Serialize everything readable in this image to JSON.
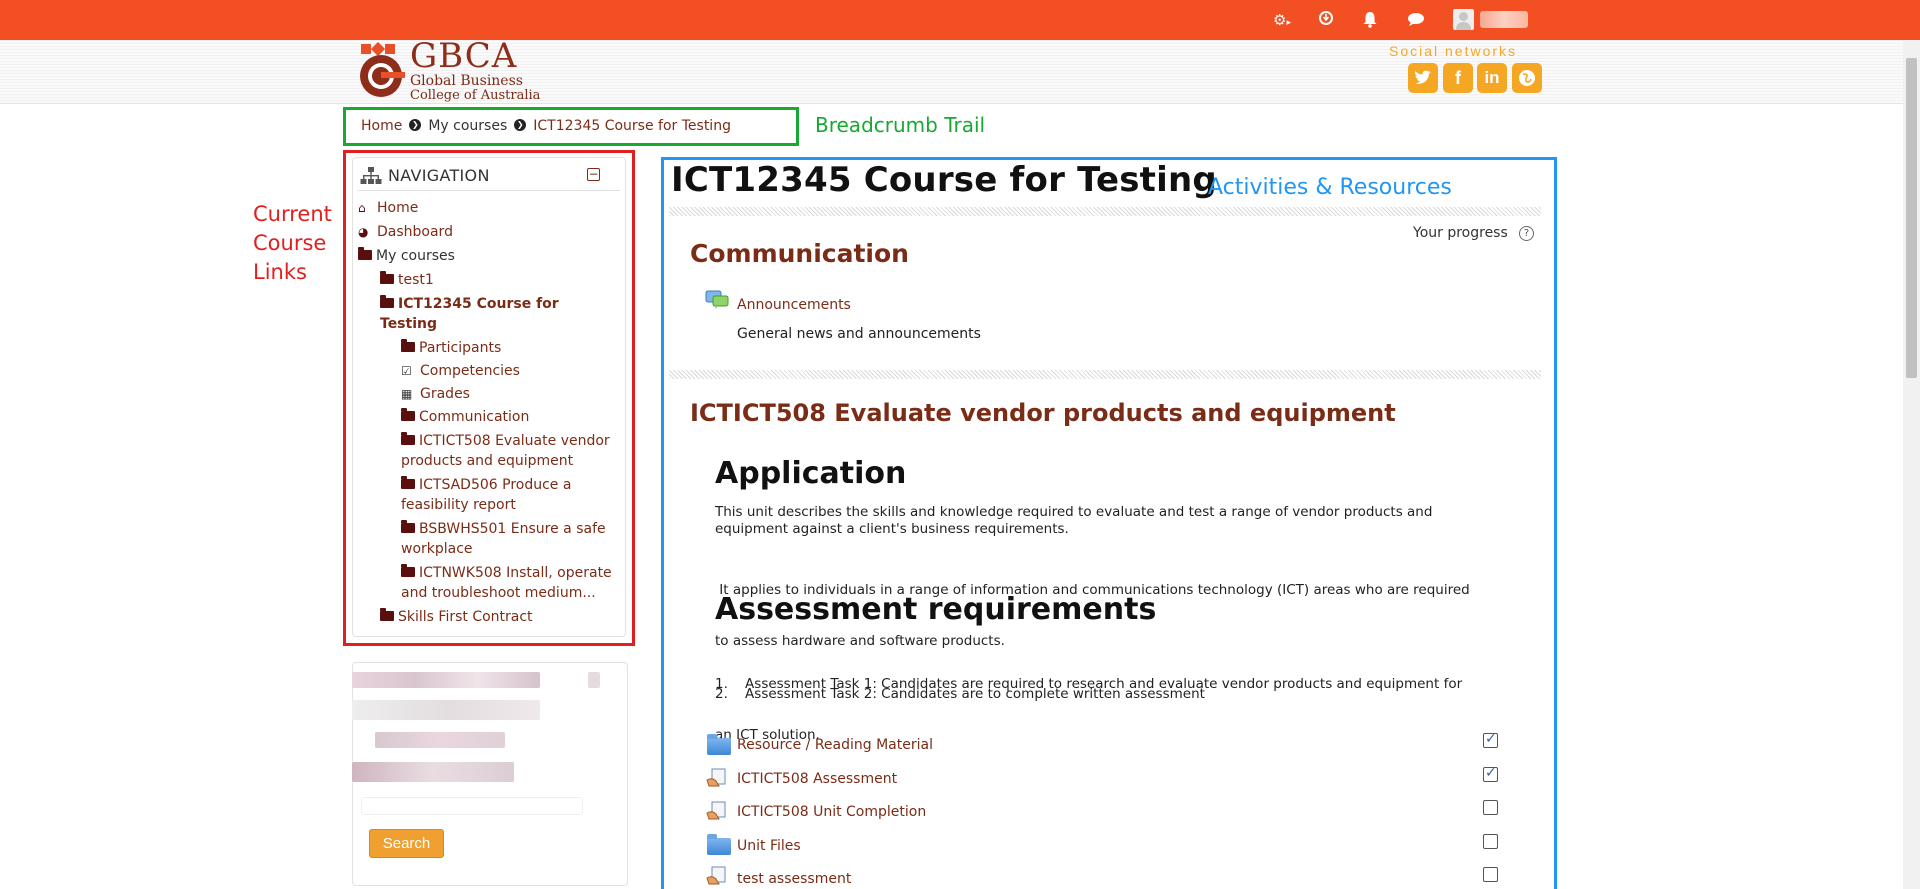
{
  "header": {
    "logo_abbr": "GBCA",
    "logo_line1": "Global Business",
    "logo_line2": "College of Australia",
    "social_label": "Social networks",
    "social": [
      "twitter-icon",
      "facebook-icon",
      "linkedin-icon",
      "globe-icon"
    ]
  },
  "topbar": {
    "icons": [
      "gear-icon",
      "arrow-circle-icon",
      "bell-icon",
      "chat-icon"
    ],
    "color": "#f25022"
  },
  "breadcrumb": {
    "items": [
      "Home",
      "My courses",
      "ICT12345 Course for Testing"
    ],
    "annotation": "Breadcrumb Trail"
  },
  "annotations": {
    "course_links": [
      "Current",
      "Course",
      "Links"
    ],
    "activities": "Activities & Resources"
  },
  "navigation": {
    "title": "NAVIGATION",
    "items": [
      {
        "label": "Home"
      },
      {
        "label": "Dashboard"
      },
      {
        "label": "My courses"
      },
      {
        "label": "test1"
      },
      {
        "label": "ICT12345 Course for",
        "label2": "Testing"
      },
      {
        "label": "Participants"
      },
      {
        "label": "Competencies"
      },
      {
        "label": "Grades"
      },
      {
        "label": "Communication"
      },
      {
        "label": "ICTICT508 Evaluate vendor",
        "label2": "products and equipment"
      },
      {
        "label": "ICTSAD506 Produce a",
        "label2": "feasibility report"
      },
      {
        "label": "BSBWHS501 Ensure a safe",
        "label2": "workplace"
      },
      {
        "label": "ICTNWK508 Install, operate",
        "label2": "and troubleshoot medium..."
      },
      {
        "label": "Skills First Contract"
      }
    ]
  },
  "search": {
    "button": "Search"
  },
  "course": {
    "title": "ICT12345 Course for Testing",
    "progress_label": "Your progress",
    "help": "?",
    "section1": {
      "title": "Communication",
      "activity": "Announcements",
      "description": "General news and announcements"
    },
    "section2": {
      "title": "ICTICT508 Evaluate vendor products and equipment",
      "h_application": "Application",
      "p1a": "This unit describes the skills and knowledge required to evaluate and test a range of vendor products and",
      "p1b": "equipment against a client's business requirements.",
      "p2a": " It applies to individuals in a range of information and communications technology (ICT) areas who are required",
      "p2b": "to assess hardware and software products.",
      "h_assessment": "Assessment requirements",
      "r1a": "1.    Assessment Task 1: Candidates are required to research and evaluate vendor products and equipment for",
      "r1b": "an ICT solution.",
      "r2": "2.    Assessment Task 2: Candidates are to complete written assessment",
      "activities": [
        {
          "label": "Resource / Reading Material",
          "icon": "folder-icon",
          "done": true
        },
        {
          "label": "ICTICT508 Assessment",
          "icon": "assignment-icon",
          "done": true
        },
        {
          "label": "ICTICT508 Unit Completion",
          "icon": "assignment-icon",
          "done": false
        },
        {
          "label": "Unit Files",
          "icon": "folder-icon",
          "done": false
        },
        {
          "label": "test assessment",
          "icon": "assignment-icon",
          "done": false
        }
      ]
    }
  }
}
